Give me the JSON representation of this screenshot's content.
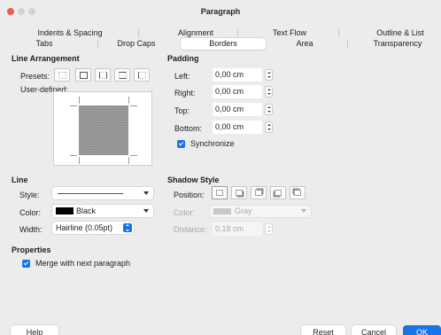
{
  "window": {
    "title": "Paragraph"
  },
  "tabs_row1": [
    {
      "label": "Indents & Spacing"
    },
    {
      "label": "Alignment"
    },
    {
      "label": "Text Flow"
    },
    {
      "label": "Outline & List"
    }
  ],
  "tabs_row2": [
    {
      "label": "Tabs"
    },
    {
      "label": "Drop Caps"
    },
    {
      "label": "Borders",
      "active": true
    },
    {
      "label": "Area"
    },
    {
      "label": "Transparency"
    }
  ],
  "line_arrangement": {
    "title": "Line Arrangement",
    "presets_label": "Presets:",
    "user_defined_label": "User-defined:"
  },
  "padding": {
    "title": "Padding",
    "left_label": "Left:",
    "left_value": "0,00 cm",
    "right_label": "Right:",
    "right_value": "0,00 cm",
    "top_label": "Top:",
    "top_value": "0,00 cm",
    "bottom_label": "Bottom:",
    "bottom_value": "0,00 cm",
    "synchronize_label": "Synchronize",
    "synchronize_checked": true
  },
  "line": {
    "title": "Line",
    "style_label": "Style:",
    "color_label": "Color:",
    "color_value": "Black",
    "color_swatch": "#000000",
    "width_label": "Width:",
    "width_value": "Hairline (0.05pt)"
  },
  "shadow_style": {
    "title": "Shadow Style",
    "position_label": "Position:",
    "color_label": "Color:",
    "color_value": "Gray",
    "color_swatch": "#c8c8c8",
    "distance_label": "Distance:",
    "distance_value": "0,18 cm"
  },
  "properties": {
    "title": "Properties",
    "merge_label": "Merge with next paragraph",
    "merge_checked": true
  },
  "buttons": {
    "help": "Help",
    "reset": "Reset",
    "cancel": "Cancel",
    "ok": "OK"
  },
  "colors": {
    "accent": "#1a74e8",
    "close": "#ee5a52",
    "traffic_inactive": "#d3d3d3"
  }
}
